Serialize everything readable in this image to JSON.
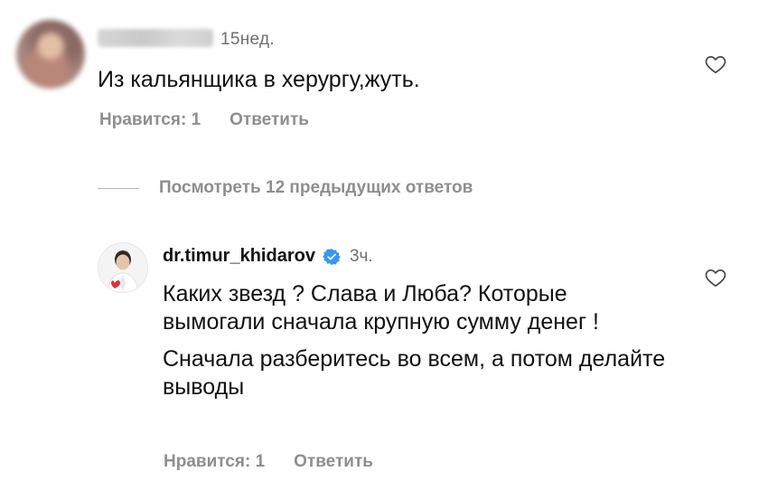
{
  "comment1": {
    "time": "15нед.",
    "text": "Из кальянщика в херургу,жуть.",
    "likes_label": "Нравится: 1",
    "reply_label": "Ответить"
  },
  "view_replies": {
    "label": "Посмотреть 12 предыдущих ответов"
  },
  "comment2": {
    "username": "dr.timur_khidarov",
    "time": "3ч.",
    "paragraph1": "Каких звезд ? Слава и Люба? Которые вымогали сначала крупную сумму денег !",
    "paragraph2": "Сначала разберитесь во всем, а потом делайте выводы",
    "likes_label": "Нравится: 1",
    "reply_label": "Ответить"
  },
  "icons": {
    "like": "heart-outline-icon",
    "verified": "verified-badge-icon"
  },
  "colors": {
    "text": "#111111",
    "secondary": "#8e8e8e",
    "verified": "#3897f0"
  }
}
